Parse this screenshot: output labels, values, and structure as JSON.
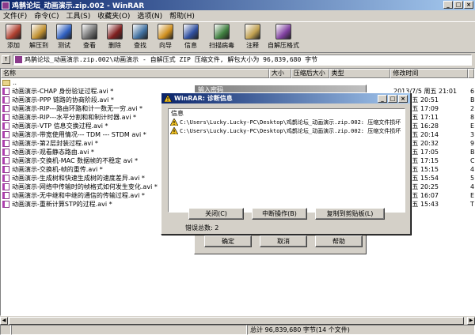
{
  "window": {
    "title": "鸡鹊论坛_动画演示.zip.002 - WinRAR",
    "min": "_",
    "max": "□",
    "close": "×"
  },
  "menu": [
    "文件(F)",
    "命令(C)",
    "工具(S)",
    "收藏夹(O)",
    "选项(N)",
    "帮助(H)"
  ],
  "toolbar": [
    {
      "label": "添加",
      "icon": "add-books-icon",
      "color": "#b04030"
    },
    {
      "label": "解压到",
      "icon": "extract-to-icon",
      "color": "#c09030"
    },
    {
      "label": "测试",
      "icon": "test-icon",
      "color": "#3060c0"
    },
    {
      "label": "查看",
      "icon": "view-icon",
      "color": "#707070"
    },
    {
      "label": "删除",
      "icon": "delete-icon",
      "color": "#802020"
    },
    {
      "label": "查找",
      "icon": "find-icon",
      "color": "#4070a0"
    },
    {
      "label": "向导",
      "icon": "wizard-icon",
      "color": "#d09020"
    },
    {
      "label": "信息",
      "icon": "info-icon",
      "color": "#3050a0"
    },
    {
      "label": "扫描病毒",
      "icon": "scan-virus-icon",
      "color": "#408040"
    },
    {
      "label": "注释",
      "icon": "comment-icon",
      "color": "#c0a050"
    },
    {
      "label": "自解压格式",
      "icon": "sfx-icon",
      "color": "#8040a0"
    }
  ],
  "path": {
    "up": "↑",
    "text": "鸡鹊论坛_动画演示.zip.002\\动画演示 - 自解压式 ZIP 压缩文件, 解包大小为 96,839,680 字节"
  },
  "columns": [
    "名称",
    "大小",
    "压缩后大小",
    "类型",
    "修改时间",
    ""
  ],
  "files": [
    {
      "name": "..",
      "date": "",
      "attr": "",
      "folder": true
    },
    {
      "name": "动画演示-CHAP 身份验证过程.avi *",
      "date": "2013/7/5 周五 21:01",
      "attr": "6:"
    },
    {
      "name": "动画演示-PPP 链路的协商阶段.avi *",
      "date": "7/5 周五 20:51",
      "attr": "B"
    },
    {
      "name": "动画演示-RIP---路由环路和计一数无一穷.avi *",
      "date": "7/5 周五 17:09",
      "attr": "2"
    },
    {
      "name": "动画演示-RIP---水平分割和和制计时器.avi *",
      "date": "7/5 周五 17:11",
      "attr": "8"
    },
    {
      "name": "动画演示-VTP 信息交换过程.avi *",
      "date": "7/5 周五 16:28",
      "attr": "E"
    },
    {
      "name": "动画演示-带宽使用情况--- TDM --- STDM avi *",
      "date": "7/5 周五 20:14",
      "attr": "3"
    },
    {
      "name": "动画演示-第2层封装过程.avi *",
      "date": "7/5 周五 20:32",
      "attr": "9"
    },
    {
      "name": "动画演示-观看静态路由.avi *",
      "date": "7/5 周五 17:05",
      "attr": "B"
    },
    {
      "name": "动画演示-交换机-MAC 数据帧的不稳定 avi *",
      "date": "7/5 周五 17:15",
      "attr": "C"
    },
    {
      "name": "动画演示-交换机-帧的重传.avi *",
      "date": "7/5 周五 15:15",
      "attr": "4"
    },
    {
      "name": "动画演示-生成树和快速生成树的速度差异.avi *",
      "date": "7/5 周五 15:54",
      "attr": "5"
    },
    {
      "name": "动画演示-网络中传输时的帧格式如何发生变化.avi *",
      "date": "7/5 周五 20:25",
      "attr": "4"
    },
    {
      "name": "动画演示-无中继和中继的通信的传输过程.avi *",
      "date": "7/5 周五 16:07",
      "attr": "E"
    },
    {
      "name": "动画演示-重新计算STP的过程.avi *",
      "date": "7/5 周五 15:43",
      "attr": "T"
    }
  ],
  "status": {
    "left": "",
    "right": "总计 96,839,680 字节(14 个文件)"
  },
  "back_dialog": {
    "title": "输入密码",
    "ok": "确定",
    "cancel": "取消",
    "help": "帮助"
  },
  "diag": {
    "title": "WinRAR: 诊断信息",
    "header": "信息",
    "messages": [
      "C:\\Users\\Lucky.Lucky-PC\\Desktop\\鸡鹊论坛_动画演示.zip.002: 压缩文件损坏",
      "C:\\Users\\Lucky.Lucky-PC\\Desktop\\鸡鹊论坛_动画演示.zip.002: 压缩文件损坏"
    ],
    "close": "关闭(C)",
    "break": "中断操作(B)",
    "copy": "复制到剪贴板(L)",
    "errors": "错误总数: 2"
  }
}
